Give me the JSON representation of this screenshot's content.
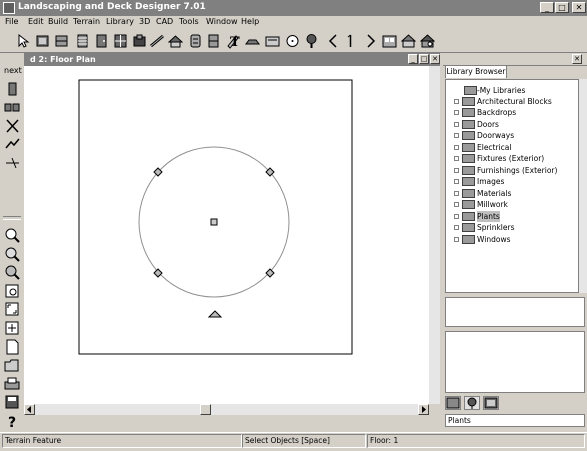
{
  "app": {
    "title": "Landscaping and Deck Designer 7.01"
  },
  "window_controls": {
    "minimize": "_",
    "maximize": "□",
    "close": "✕"
  },
  "menu": [
    "File",
    "Edit",
    "Build",
    "Terrain",
    "Library",
    "3D",
    "CAD",
    "Tools",
    "Window",
    "Help"
  ],
  "left_toolbar": {
    "next_label": "next"
  },
  "doc_window": {
    "title": "d 2: Floor Plan"
  },
  "library": {
    "tab": "Library Browser",
    "items": [
      {
        "label": "-My Libraries",
        "selected": false
      },
      {
        "label": "Architectural Blocks",
        "selected": false
      },
      {
        "label": "Backdrops",
        "selected": false
      },
      {
        "label": "Doors",
        "selected": false
      },
      {
        "label": "Doorways",
        "selected": false
      },
      {
        "label": "Electrical",
        "selected": false
      },
      {
        "label": "Fixtures (Exterior)",
        "selected": false
      },
      {
        "label": "Furnishings (Exterior)",
        "selected": false
      },
      {
        "label": "Images",
        "selected": false
      },
      {
        "label": "Materials",
        "selected": false
      },
      {
        "label": "Millwork",
        "selected": false
      },
      {
        "label": "Plants",
        "selected": true
      },
      {
        "label": "Sprinklers",
        "selected": false
      },
      {
        "label": "Windows",
        "selected": false
      }
    ],
    "selected_name": "Plants"
  },
  "status": {
    "left": "Terrain Feature",
    "mid": "Select Objects [Space]",
    "right": "Floor: 1"
  },
  "icons": {
    "toolbar": [
      "select-arrow-icon",
      "wall-icon",
      "cabinet-icon",
      "stair-icon",
      "door-icon",
      "window-icon",
      "deck-icon",
      "fence-icon",
      "roof-icon",
      "terrain-icon",
      "room-icon",
      "pencil-icon",
      "text-icon",
      "dimension-icon",
      "library-icon",
      "circle-icon",
      "plant-icon",
      "prev-icon",
      "up-icon",
      "next-icon",
      "plan-view-icon",
      "elevation-icon",
      "camera-icon"
    ],
    "left": [
      "select-icon",
      "wall-tool-icon",
      "break-icon",
      "delete-icon",
      "connect-icon",
      "split-icon",
      "zoom-in-icon",
      "zoom-tool-icon",
      "zoom-out-icon",
      "zoom-box-icon",
      "fill-window-icon",
      "page-icon",
      "new-icon",
      "open-icon",
      "print-icon",
      "save-icon",
      "help-icon"
    ]
  }
}
